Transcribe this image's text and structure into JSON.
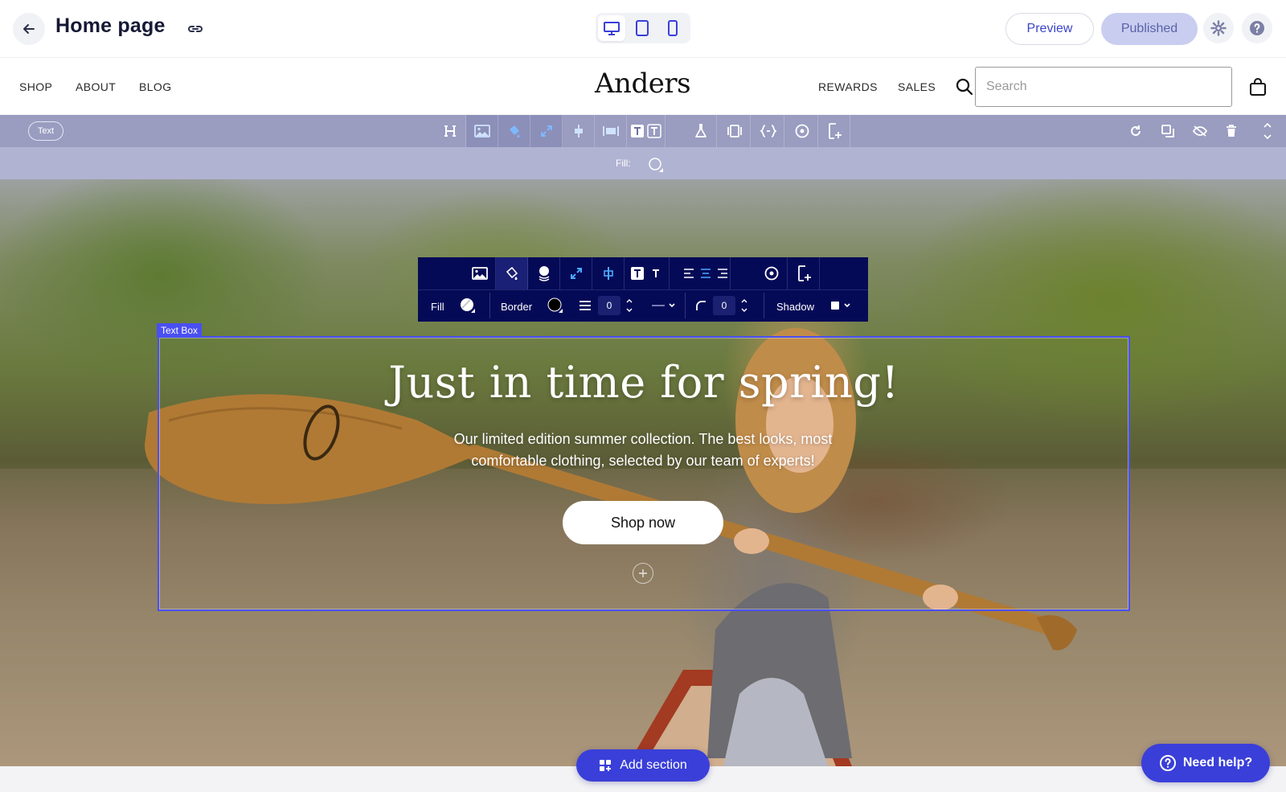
{
  "editor": {
    "page_title": "Home page",
    "preview_label": "Preview",
    "published_label": "Published",
    "devices": [
      "desktop",
      "tablet",
      "mobile"
    ],
    "active_device": "desktop"
  },
  "store": {
    "nav_left": [
      "SHOP",
      "ABOUT",
      "BLOG"
    ],
    "logo": "Anders",
    "nav_right": [
      "REWARDS",
      "SALES"
    ],
    "search_placeholder": "Search"
  },
  "section_toolbar": {
    "tag": "Text",
    "fill_label": "Fill:"
  },
  "element_toolbar": {
    "fill_label": "Fill",
    "border_label": "Border",
    "border_width": "0",
    "radius": "0",
    "shadow_label": "Shadow"
  },
  "hero": {
    "selection_label": "Text Box",
    "heading": "Just in time for spring!",
    "subheading": "Our limited edition summer collection. The best looks, most comfortable clothing, selected by our team of experts!",
    "cta_label": "Shop now"
  },
  "bottom": {
    "add_section_label": "Add section",
    "need_help_label": "Need help?"
  },
  "colors": {
    "accent": "#3a3fd9",
    "selection": "#4a4ff2",
    "toolbar_dark": "#050a57",
    "section_toolbar": "#9a9cc0"
  }
}
